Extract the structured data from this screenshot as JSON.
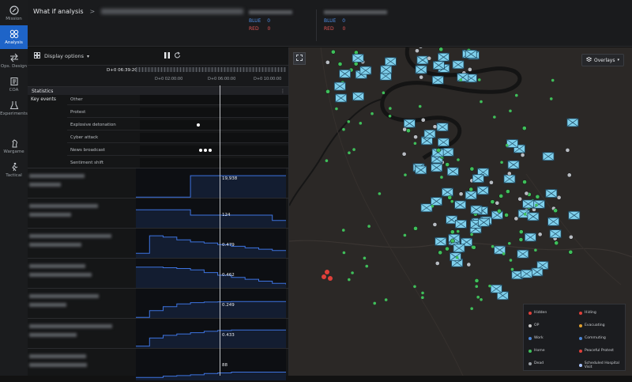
{
  "nav": {
    "items": [
      {
        "label": "Mission",
        "icon": "mission-icon"
      },
      {
        "label": "Analysis",
        "icon": "analysis-icon",
        "active": true
      },
      {
        "label": "Ops. Design",
        "icon": "ops-design-icon"
      },
      {
        "label": "COA",
        "icon": "coa-icon"
      },
      {
        "label": "Experiments",
        "icon": "experiments-icon"
      },
      {
        "label": "Wargame",
        "icon": "wargame-icon"
      },
      {
        "label": "Tactical",
        "icon": "tactical-icon"
      }
    ]
  },
  "header": {
    "title": "What if analysis",
    "sep": ">"
  },
  "scores": [
    {
      "side": "BLUE",
      "value": "0",
      "color": "#4f8fe8"
    },
    {
      "side": "RED",
      "value": "0",
      "color": "#e05555"
    }
  ],
  "controls": {
    "display_options": "Display options",
    "chevron": "▾"
  },
  "timeline": {
    "current": "D+0 06:39:20",
    "ticks": [
      "D+0 02:00:00",
      "D+0 06:00:00",
      "D+0 10:00:00"
    ]
  },
  "statistics": {
    "header": "Statistics",
    "key_events_label": "Key events"
  },
  "events": [
    "Other",
    "Protest",
    "Explosive detonation",
    "Cyber attack",
    "News broadcast",
    "Sentiment shift"
  ],
  "metrics": [
    {
      "value": "19,938",
      "trend": [
        0.05,
        0.05,
        0.05,
        0.05,
        0.85,
        0.85,
        0.85,
        0.85,
        0.85,
        0.85,
        0.85,
        0.85
      ]
    },
    {
      "value": "124",
      "trend": [
        0.7,
        0.7,
        0.7,
        0.7,
        0.5,
        0.5,
        0.5,
        0.5,
        0.5,
        0.5,
        0.3,
        0.3
      ]
    },
    {
      "value": "0.479",
      "trend": [
        0.2,
        0.85,
        0.8,
        0.7,
        0.62,
        0.58,
        0.52,
        0.46,
        0.4,
        0.35,
        0.3,
        0.3
      ]
    },
    {
      "value": "0.462",
      "trend": [
        0.8,
        0.8,
        0.78,
        0.75,
        0.7,
        0.6,
        0.5,
        0.42,
        0.35,
        0.28,
        0.2,
        0.15
      ]
    },
    {
      "value": "0.249",
      "trend": [
        0.05,
        0.3,
        0.45,
        0.55,
        0.6,
        0.62,
        0.63,
        0.64,
        0.64,
        0.64,
        0.64,
        0.64
      ]
    },
    {
      "value": "0.433",
      "trend": [
        0.1,
        0.4,
        0.5,
        0.55,
        0.6,
        0.65,
        0.68,
        0.7,
        0.7,
        0.7,
        0.7,
        0.7
      ]
    },
    {
      "value": "88",
      "trend": [
        0.05,
        0.05,
        0.1,
        0.12,
        0.15,
        0.2,
        0.22,
        0.25,
        0.25,
        0.25,
        0.25,
        0.25
      ]
    }
  ],
  "map": {
    "overlays_label": "Overlays",
    "legend": [
      {
        "label": "Hidden",
        "color": "#e0403a"
      },
      {
        "label": "Hiding",
        "color": "#e0403a"
      },
      {
        "label": "OP",
        "color": "#c8c8c8"
      },
      {
        "label": "Evacuating",
        "color": "#e0a030"
      },
      {
        "label": "Work",
        "color": "#4d87d6"
      },
      {
        "label": "Commuting",
        "color": "#4d87d6"
      },
      {
        "label": "Home",
        "color": "#3fbf5a"
      },
      {
        "label": "Peaceful Protest",
        "color": "#e0403a"
      },
      {
        "label": "Dead",
        "color": "#9aa0a6"
      },
      {
        "label": "Scheduled Hospital Visit",
        "color": "#a9c4ff"
      }
    ]
  },
  "colors": {
    "accent": "#1e64c8",
    "metric_line": "#3d73e0",
    "green": "#3fbf5a",
    "cyan": "#3fb2d8"
  }
}
